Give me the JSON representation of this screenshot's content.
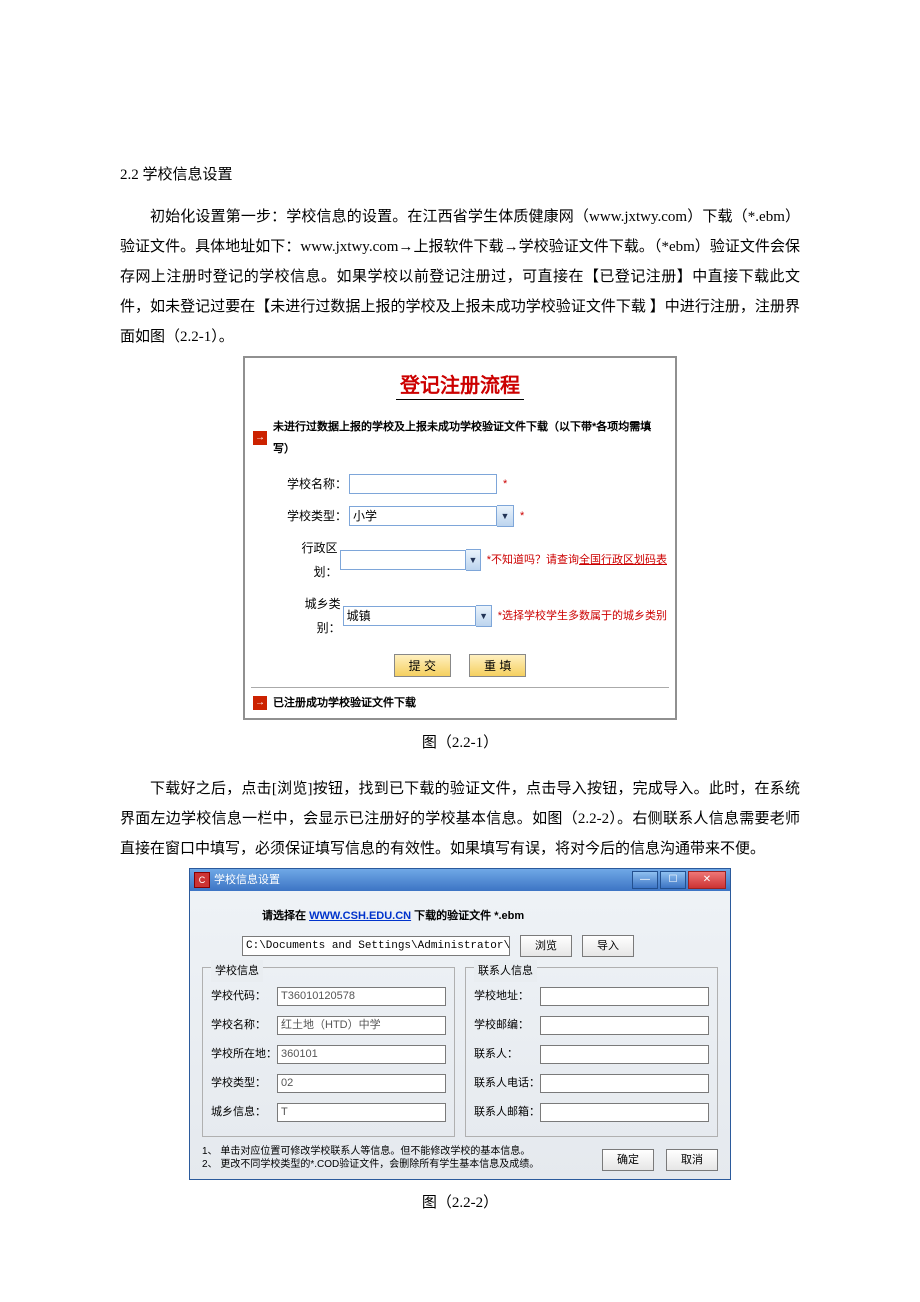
{
  "section_title": "2.2 学校信息设置",
  "para1": "初始化设置第一步：学校信息的设置。在江西省学生体质健康网（www.jxtwy.com）下载（*.ebm）验证文件。具体地址如下：www.jxtwy.com→上报软件下载→学校验证文件下载。（*ebm）验证文件会保存网上注册时登记的学校信息。如果学校以前登记注册过，可直接在【已登记注册】中直接下载此文件，如未登记过要在【未进行过数据上报的学校及上报未成功学校验证文件下载 】中进行注册，注册界面如图（2.2-1）。",
  "caption1": "图（2.2-1）",
  "para2": "下载好之后，点击[浏览]按钮，找到已下载的验证文件，点击导入按钮，完成导入。此时，在系统界面左边学校信息一栏中，会显示已注册好的学校基本信息。如图（2.2-2）。右侧联系人信息需要老师直接在窗口中填写，必须保证填写信息的有效性。如果填写有误，将对今后的信息沟通带来不便。",
  "caption2": "图（2.2-2）",
  "fig1": {
    "title": "登记注册流程",
    "sub1": "未进行过数据上报的学校及上报未成功学校验证文件下载（以下带*各项均需填写）",
    "label_name": "学校名称：",
    "label_type": "学校类型：",
    "type_value": "小学",
    "note_type": "*",
    "label_region": "行政区划：",
    "note_region_pre": "*不知道吗？请查询",
    "note_region_link": "全国行政区划码表",
    "label_area": "城乡类别：",
    "area_value": "城镇",
    "note_area": "*选择学校学生多数属于的城乡类别",
    "btn_submit": "提 交",
    "btn_reset": "重 填",
    "sub2": "已注册成功学校验证文件下载"
  },
  "fig2": {
    "title": "学校信息设置",
    "hint_pre": "请选择在  ",
    "hint_link": "WWW.CSH.EDU.CN",
    "hint_post": " 下载的验证文件 *.ebm",
    "path": "C:\\Documents and Settings\\Administrator\\J",
    "btn_browse": "浏览",
    "btn_import": "导入",
    "group_left": "学校信息",
    "group_right": "联系人信息",
    "l_code": "学校代码：",
    "v_code": "T36010120578",
    "l_name": "学校名称：",
    "v_name": "红土地（HTD）中学",
    "l_loc": "学校所在地：",
    "v_loc": "360101",
    "l_type": "学校类型：",
    "v_type": "02",
    "l_area": "城乡信息：",
    "v_area": "T",
    "r_addr": "学校地址：",
    "r_zip": "学校邮编：",
    "r_contact": "联系人：",
    "r_phone": "联系人电话：",
    "r_mail": "联系人邮箱：",
    "footer_notes": "1、 单击对应位置可修改学校联系人等信息。但不能修改学校的基本信息。\n2、 更改不同学校类型的*.COD验证文件，会删除所有学生基本信息及成绩。",
    "btn_ok": "确定",
    "btn_cancel": "取消"
  }
}
